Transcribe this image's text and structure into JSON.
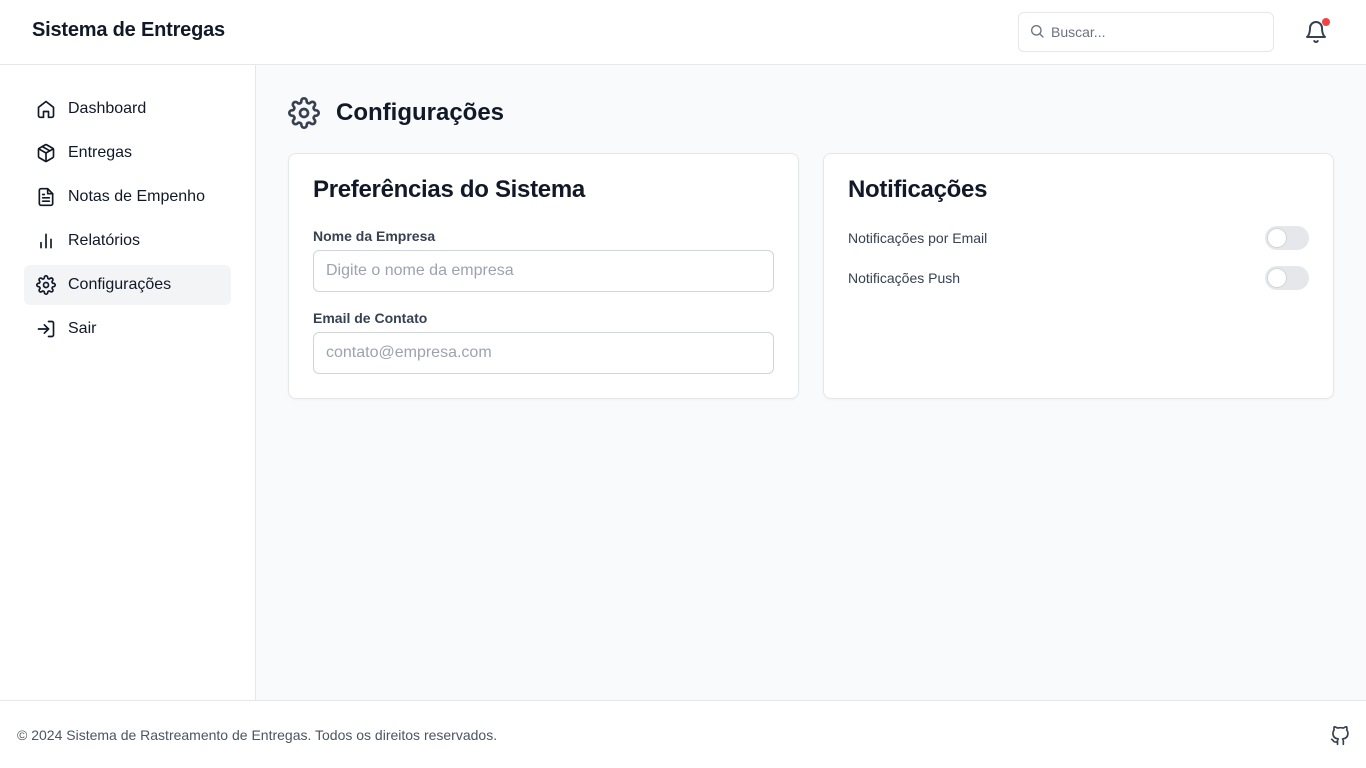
{
  "header": {
    "title": "Sistema de Entregas",
    "search_placeholder": "Buscar...",
    "search_icon": "search-icon",
    "notification_icon": "bell-icon"
  },
  "sidebar": {
    "items": [
      {
        "label": "Dashboard",
        "icon": "home-icon",
        "active": false
      },
      {
        "label": "Entregas",
        "icon": "package-icon",
        "active": false
      },
      {
        "label": "Notas de Empenho",
        "icon": "file-text-icon",
        "active": false
      },
      {
        "label": "Relatórios",
        "icon": "bar-chart-icon",
        "active": false
      },
      {
        "label": "Configurações",
        "icon": "gear-icon",
        "active": true
      },
      {
        "label": "Sair",
        "icon": "log-in-icon",
        "active": false
      }
    ]
  },
  "main": {
    "page_title": "Configurações",
    "page_icon": "gear-icon",
    "preferences": {
      "title": "Preferências do Sistema",
      "company_label": "Nome da Empresa",
      "company_placeholder": "Digite o nome da empresa",
      "company_value": "",
      "email_label": "Email de Contato",
      "email_placeholder": "contato@empresa.com",
      "email_value": ""
    },
    "notifications": {
      "title": "Notificações",
      "email_label": "Notificações por Email",
      "email_enabled": false,
      "push_label": "Notificações Push",
      "push_enabled": false
    }
  },
  "footer": {
    "text": "© 2024 Sistema de Rastreamento de Entregas. Todos os direitos reservados.",
    "icon": "github-icon"
  },
  "colors": {
    "active_nav_bg": "#f3f4f6",
    "main_bg": "#f9fafb",
    "notification_dot": "#ef4444",
    "toggle_off": "#e5e7eb"
  }
}
